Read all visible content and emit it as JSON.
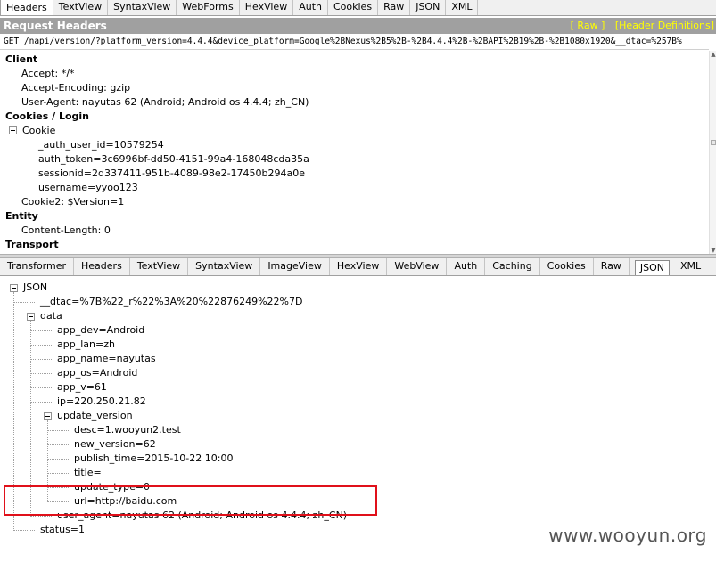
{
  "request_tabs": [
    {
      "label": "Headers",
      "active": true
    },
    {
      "label": "TextView",
      "active": false
    },
    {
      "label": "SyntaxView",
      "active": false
    },
    {
      "label": "WebForms",
      "active": false
    },
    {
      "label": "HexView",
      "active": false
    },
    {
      "label": "Auth",
      "active": false
    },
    {
      "label": "Cookies",
      "active": false
    },
    {
      "label": "Raw",
      "active": false
    },
    {
      "label": "JSON",
      "active": false
    },
    {
      "label": "XML",
      "active": false
    }
  ],
  "request_headers": {
    "title": "Request Headers",
    "raw_link": "[ Raw ]",
    "definitions_link": "[Header Definitions]",
    "request_line": "GET /napi/version/?platform_version=4.4.4&device_platform=Google%2BNexus%2B5%2B-%2B4.4.4%2B-%2BAPI%2B19%2B-%2B1080x1920&__dtac=%257B%",
    "client_label": "Client",
    "accept": "Accept: */*",
    "accept_encoding": "Accept-Encoding: gzip",
    "user_agent": "User-Agent: nayutas 62 (Android; Android os 4.4.4; zh_CN)",
    "cookies_label": "Cookies / Login",
    "cookie_label": "Cookie",
    "cookie_values": [
      "_auth_user_id=10579254",
      "auth_token=3c6996bf-dd50-4151-99a4-168048cda35a",
      "sessionid=2d337411-951b-4089-98e2-17450b294a0e",
      "username=yyoo123"
    ],
    "cookie2": "Cookie2: $Version=1",
    "entity_label": "Entity",
    "content_length": "Content-Length: 0",
    "transport_label": "Transport"
  },
  "response_tabs": [
    {
      "label": "Transformer",
      "active": false
    },
    {
      "label": "Headers",
      "active": false
    },
    {
      "label": "TextView",
      "active": false
    },
    {
      "label": "SyntaxView",
      "active": false
    },
    {
      "label": "ImageView",
      "active": false
    },
    {
      "label": "HexView",
      "active": false
    },
    {
      "label": "WebView",
      "active": false
    },
    {
      "label": "Auth",
      "active": false
    },
    {
      "label": "Caching",
      "active": false
    },
    {
      "label": "Cookies",
      "active": false
    },
    {
      "label": "Raw",
      "active": false
    },
    {
      "label": "JSON",
      "active": true
    },
    {
      "label": "XML",
      "active": false
    }
  ],
  "json_tree": {
    "root": "JSON",
    "dtac": "__dtac=%7B%22_r%22%3A%20%22876249%22%7D",
    "data_label": "data",
    "data_items": [
      "app_dev=Android",
      "app_lan=zh",
      "app_name=nayutas",
      "app_os=Android",
      "app_v=61",
      "ip=220.250.21.82"
    ],
    "update_version_label": "update_version",
    "update_items": [
      "desc=1.wooyun2.test",
      "new_version=62",
      "publish_time=2015-10-22 10:00",
      "title=",
      "update_type=0",
      "url=http://baidu.com"
    ],
    "user_agent": "user_agent=nayutas 62 (Android; Android os 4.4.4; zh_CN)",
    "status": "status=1"
  },
  "watermark": "www.wooyun.org",
  "colors": {
    "title_bar": "#a0a0a0",
    "link_yellow": "#ffff00",
    "highlight_red": "#e0101a"
  }
}
